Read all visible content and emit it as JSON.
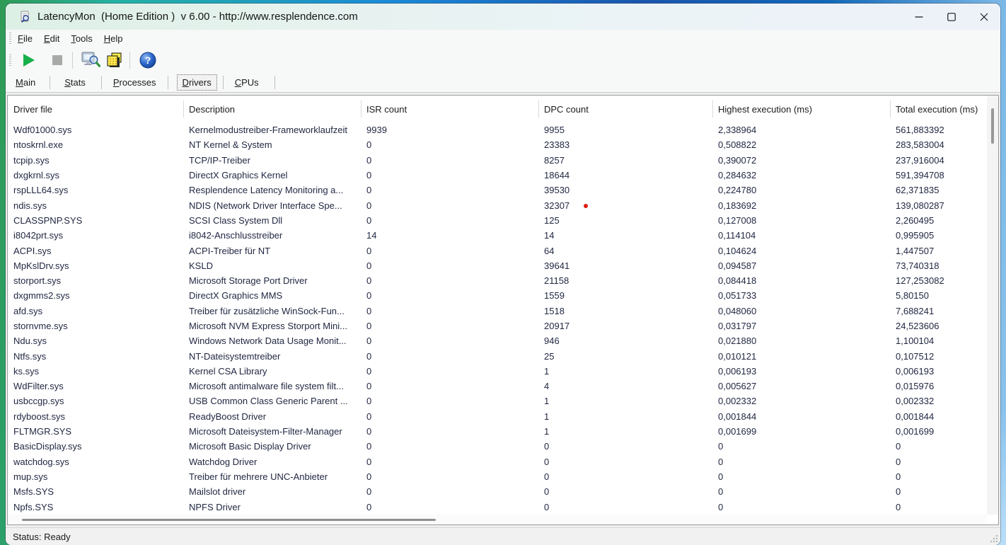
{
  "window": {
    "title": "LatencyMon  (Home Edition )  v 6.00 - http://www.resplendence.com",
    "controls": [
      "minimize",
      "maximize",
      "close"
    ]
  },
  "menu": {
    "items": [
      {
        "label": "File"
      },
      {
        "label": "Edit"
      },
      {
        "label": "Tools"
      },
      {
        "label": "Help"
      }
    ]
  },
  "toolbar": {
    "buttons": [
      {
        "name": "start-monitor",
        "icon": "play-icon",
        "enabled": true
      },
      {
        "name": "stop-monitor",
        "icon": "stop-icon",
        "enabled": false
      },
      {
        "name": "analyze",
        "icon": "monitor-magnifier-icon",
        "enabled": true
      },
      {
        "name": "windows",
        "icon": "layers-icon",
        "enabled": true
      },
      {
        "name": "help",
        "icon": "help-icon",
        "enabled": true
      }
    ]
  },
  "tabs": {
    "items": [
      {
        "label": "Main",
        "selected": false
      },
      {
        "label": "Stats",
        "selected": false
      },
      {
        "label": "Processes",
        "selected": false
      },
      {
        "label": "Drivers",
        "selected": true
      },
      {
        "label": "CPUs",
        "selected": false
      }
    ]
  },
  "table": {
    "columns": [
      "Driver file",
      "Description",
      "ISR count",
      "DPC count",
      "Highest execution (ms)",
      "Total execution (ms)"
    ],
    "rows": [
      [
        "Wdf01000.sys",
        "Kernelmodustreiber-Frameworklaufzeit",
        "9939",
        "9955",
        "2,338964",
        "561,883392"
      ],
      [
        "ntoskrnl.exe",
        "NT Kernel & System",
        "0",
        "23383",
        "0,508822",
        "283,583004"
      ],
      [
        "tcpip.sys",
        "TCP/IP-Treiber",
        "0",
        "8257",
        "0,390072",
        "237,916004"
      ],
      [
        "dxgkrnl.sys",
        "DirectX Graphics Kernel",
        "0",
        "18644",
        "0,284632",
        "591,394708"
      ],
      [
        "rspLLL64.sys",
        "Resplendence Latency Monitoring a...",
        "0",
        "39530",
        "0,224780",
        "62,371835"
      ],
      [
        "ndis.sys",
        "NDIS (Network Driver Interface Spe...",
        "0",
        "32307",
        "0,183692",
        "139,080287"
      ],
      [
        "CLASSPNP.SYS",
        "SCSI Class System Dll",
        "0",
        "125",
        "0,127008",
        "2,260495"
      ],
      [
        "i8042prt.sys",
        "i8042-Anschlusstreiber",
        "14",
        "14",
        "0,114104",
        "0,995905"
      ],
      [
        "ACPI.sys",
        "ACPI-Treiber für NT",
        "0",
        "64",
        "0,104624",
        "1,447507"
      ],
      [
        "MpKslDrv.sys",
        "KSLD",
        "0",
        "39641",
        "0,094587",
        "73,740318"
      ],
      [
        "storport.sys",
        "Microsoft Storage Port Driver",
        "0",
        "21158",
        "0,084418",
        "127,253082"
      ],
      [
        "dxgmms2.sys",
        "DirectX Graphics MMS",
        "0",
        "1559",
        "0,051733",
        "5,80150"
      ],
      [
        "afd.sys",
        "Treiber für zusätzliche WinSock-Fun...",
        "0",
        "1518",
        "0,048060",
        "7,688241"
      ],
      [
        "stornvme.sys",
        "Microsoft NVM Express Storport Mini...",
        "0",
        "20917",
        "0,031797",
        "24,523606"
      ],
      [
        "Ndu.sys",
        "Windows Network Data Usage Monit...",
        "0",
        "946",
        "0,021880",
        "1,100104"
      ],
      [
        "Ntfs.sys",
        "NT-Dateisystemtreiber",
        "0",
        "25",
        "0,010121",
        "0,107512"
      ],
      [
        "ks.sys",
        "Kernel CSA Library",
        "0",
        "1",
        "0,006193",
        "0,006193"
      ],
      [
        "WdFilter.sys",
        "Microsoft antimalware file system filt...",
        "0",
        "4",
        "0,005627",
        "0,015976"
      ],
      [
        "usbccgp.sys",
        "USB Common Class Generic Parent ...",
        "0",
        "1",
        "0,002332",
        "0,002332"
      ],
      [
        "rdyboost.sys",
        "ReadyBoost Driver",
        "0",
        "1",
        "0,001844",
        "0,001844"
      ],
      [
        "FLTMGR.SYS",
        "Microsoft Dateisystem-Filter-Manager",
        "0",
        "1",
        "0,001699",
        "0,001699"
      ],
      [
        "BasicDisplay.sys",
        "Microsoft Basic Display Driver",
        "0",
        "0",
        "0",
        "0"
      ],
      [
        "watchdog.sys",
        "Watchdog Driver",
        "0",
        "0",
        "0",
        "0"
      ],
      [
        "mup.sys",
        "Treiber für mehrere UNC-Anbieter",
        "0",
        "0",
        "0",
        "0"
      ],
      [
        "Msfs.SYS",
        "Mailslot driver",
        "0",
        "0",
        "0",
        "0"
      ],
      [
        "Npfs.SYS",
        "NPFS Driver",
        "0",
        "0",
        "0",
        "0"
      ]
    ]
  },
  "status_bar": {
    "text": "Status: Ready"
  },
  "colors": {
    "play_green": "#17b04b",
    "stop_gray": "#a8aaa8",
    "help_blue": "#2b66cc",
    "titlebar_tint_left": "#ddf0e6",
    "red_dot": "#dd1d12"
  }
}
